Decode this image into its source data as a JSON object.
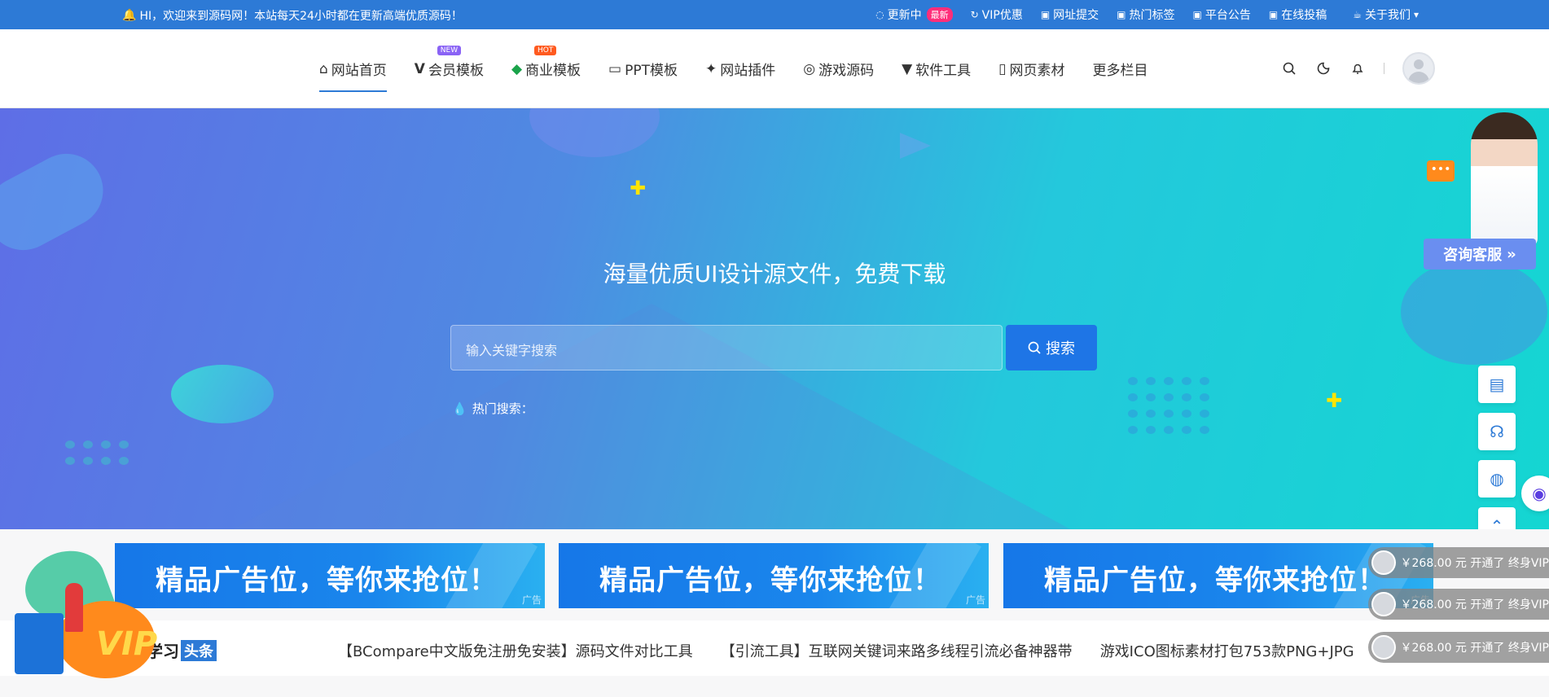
{
  "topbar": {
    "notice": "HI，欢迎来到源码网！本站每天24小时都在更新高端优质源码！",
    "links": [
      {
        "label": "更新中",
        "badge": "最新"
      },
      {
        "label": "VIP优惠"
      },
      {
        "label": "网址提交"
      },
      {
        "label": "热门标签"
      },
      {
        "label": "平台公告"
      },
      {
        "label": "在线投稿"
      },
      {
        "label": "关于我们"
      }
    ]
  },
  "nav": {
    "items": [
      {
        "label": "网站首页",
        "icon": "home-icon"
      },
      {
        "label": "会员模板",
        "icon": "v-icon",
        "tag": "NEW"
      },
      {
        "label": "商业模板",
        "icon": "logo-icon",
        "tag": "HOT"
      },
      {
        "label": "PPT模板",
        "icon": "monitor-icon"
      },
      {
        "label": "网站插件",
        "icon": "plugin-icon"
      },
      {
        "label": "游戏源码",
        "icon": "gamepad-icon"
      },
      {
        "label": "软件工具",
        "icon": "html5-icon"
      },
      {
        "label": "网页素材",
        "icon": "file-icon"
      },
      {
        "label": "更多栏目"
      }
    ]
  },
  "hero": {
    "title": "海量优质UI设计源文件，免费下载",
    "search_placeholder": "输入关键字搜索",
    "search_button": "搜索",
    "hot_search_label": "热门搜索："
  },
  "service": {
    "button": "咨询客服",
    "chat_bubble": "•••"
  },
  "ads": [
    {
      "text": "精品广告位，等你来抢位！",
      "label": "广告"
    },
    {
      "text": "精品广告位，等你来抢位！",
      "label": "广告"
    },
    {
      "text": "精品广告位，等你来抢位！",
      "label": "广告"
    }
  ],
  "headline": {
    "title": "学习",
    "badge": "头条",
    "items": [
      "【BCompare中文版免注册免安装】源码文件对比工具",
      "【引流工具】互联网关键词来路多线程引流必备神器带",
      "游戏ICO图标素材打包753款PNG+JPG"
    ]
  },
  "vip_notices": [
    "￥268.00 元 开通了 终身VIP",
    "￥268.00 元 开通了 终身VIP",
    "￥268.00 元 开通了 终身VIP"
  ],
  "gift_label": "VIP",
  "colors": {
    "topbar": "#2d7ad6",
    "search_button": "#1e75e6",
    "tag_new": "#8a63f5",
    "tag_hot": "#ff5a1f",
    "badge": "#ff2e7a"
  }
}
